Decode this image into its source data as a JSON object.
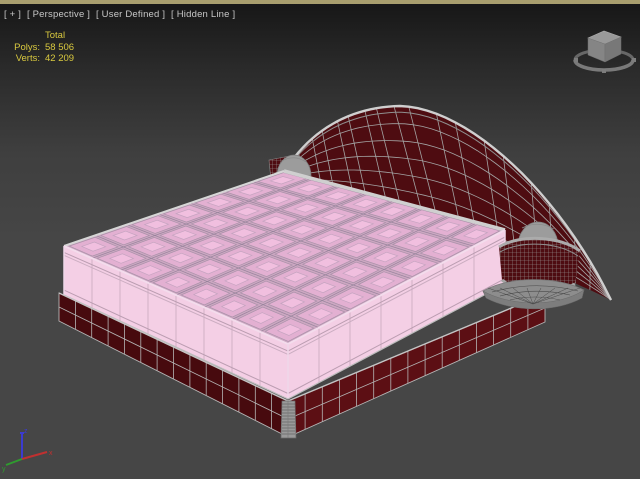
{
  "viewport": {
    "header": {
      "general_menu": "[ + ]",
      "pov_menu": "[ Perspective ]",
      "camera_menu": "[ User Defined ]",
      "shading_menu": "[ Hidden Line ]"
    },
    "statistics": {
      "total_label": "Total",
      "polys_label": "Polys:",
      "polys_value": "58 506",
      "verts_label": "Verts:",
      "verts_value": "42 209"
    },
    "axis": {
      "x_label": "x",
      "y_label": "y",
      "z_label": "z"
    }
  },
  "icons": {
    "viewcube": "viewcube-navigation-gizmo",
    "axis_tripod": "world-axis-tripod"
  },
  "colors": {
    "bg_top": "#161616",
    "bg_mid": "#3f3f3f",
    "bg_bottom": "#464646",
    "active_border": "#a89e6e",
    "label_text": "#c8c8c8",
    "stats_text": "#d9c93f",
    "headboard": "#4e0c11",
    "frame_left": "#470a0e",
    "frame_right": "#5c0f14",
    "mattress_seam": "#cda7c2",
    "mattress_cell": "#e3b0d2",
    "mattress_tuft": "#f1bfdf",
    "mattress_side": "#f4cfe5",
    "wireframe": "#a4a4a4",
    "wire_bright": "#cfcfcf",
    "metal_gray": "#9a9a9a",
    "axis_x": "#c03030",
    "axis_y": "#2f9b2f",
    "axis_z": "#3b3bd0"
  }
}
